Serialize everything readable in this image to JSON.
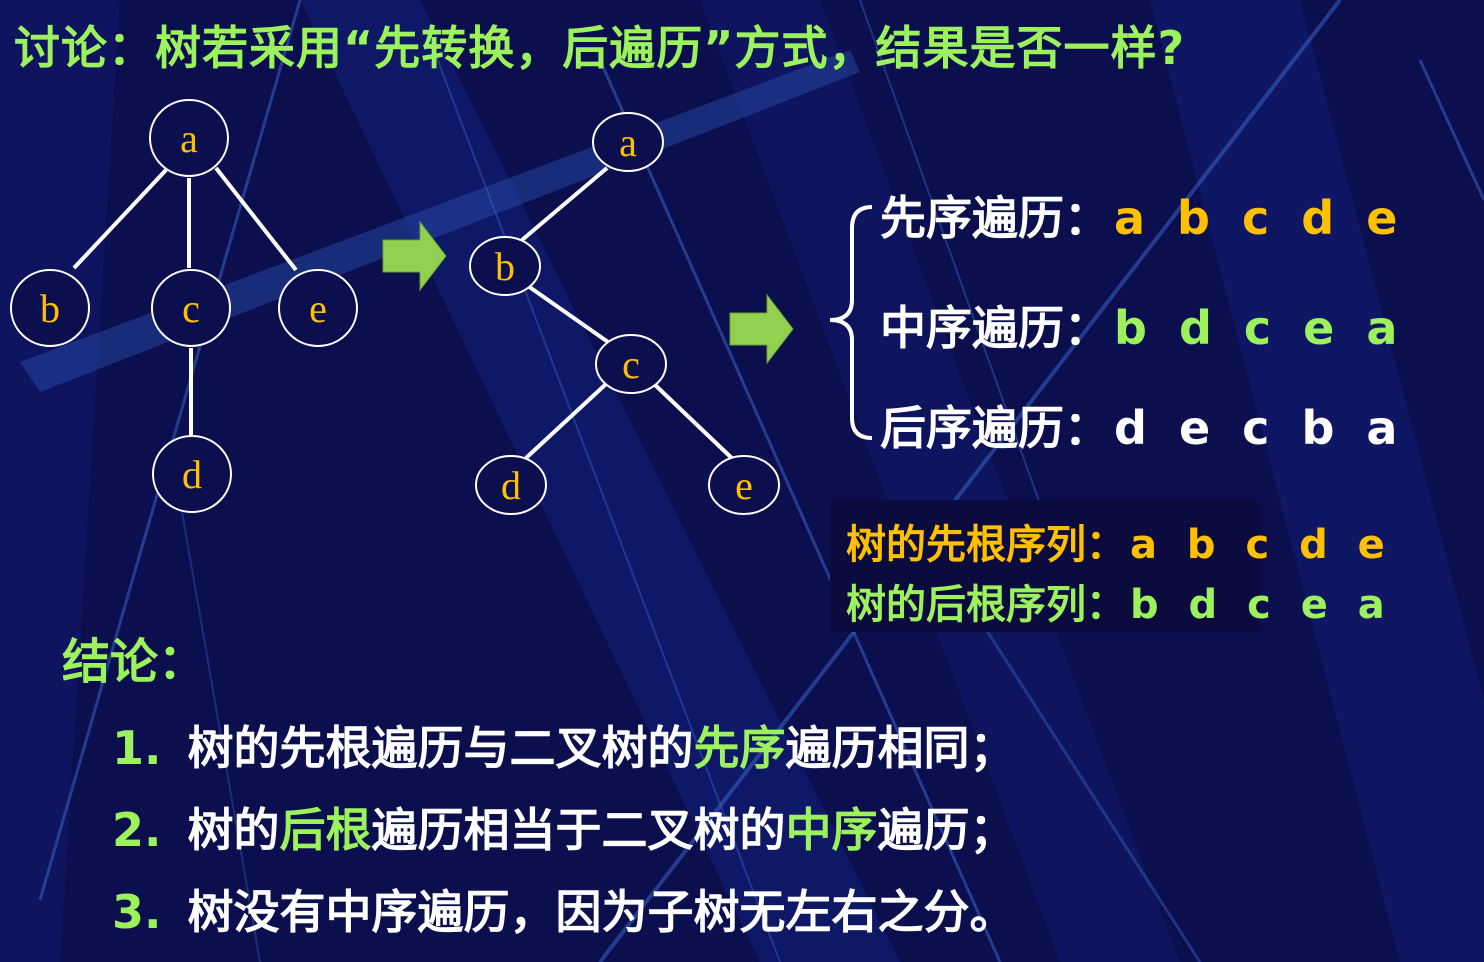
{
  "title": "讨论：树若采用“先转换，后遍历”方式，结果是否一样?",
  "colors": {
    "background": "#0c0f4e",
    "green": "#9cf25c",
    "yellow": "#ffc000",
    "white": "#ffffff"
  },
  "tree": {
    "nodes": [
      "a",
      "b",
      "c",
      "e",
      "d"
    ]
  },
  "binary_tree": {
    "nodes": [
      "a",
      "b",
      "c",
      "d",
      "e"
    ]
  },
  "traversals": {
    "pre_label": "先序遍历：",
    "pre_seq": "a b c d e",
    "in_label": "中序遍历：",
    "in_seq": "b d c e a",
    "post_label": "后序遍历：",
    "post_seq": "d e c b a"
  },
  "root_orders": {
    "pre_label": "树的先根序列：",
    "pre_seq": "a b c d e",
    "post_label": "树的后根序列：",
    "post_seq": "b d c e a"
  },
  "conclusion": {
    "title": "结论：",
    "items": [
      {
        "num": "1.",
        "a": "树的先根遍历与二叉树的",
        "b": "先序",
        "c": "遍历相同；"
      },
      {
        "num": "2.",
        "a": "树的",
        "b": "后根",
        "c": "遍历相当于二叉树的",
        "d": "中序",
        "e": "遍历；"
      },
      {
        "num": "3.",
        "a": "树没有中序遍历，因为子树无左右之分。"
      }
    ]
  }
}
